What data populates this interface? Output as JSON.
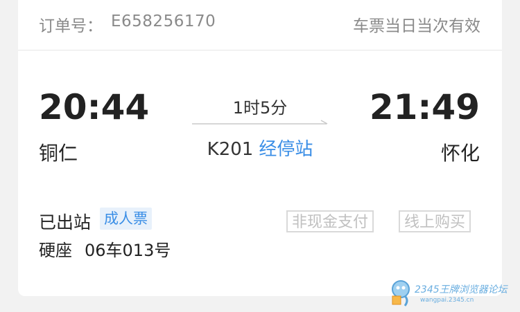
{
  "order": {
    "label": "订单号：",
    "number": "E658256170",
    "validity": "车票当日当次有效"
  },
  "journey": {
    "departure": {
      "time": "20:44",
      "station": "铜仁"
    },
    "arrival": {
      "time": "21:49",
      "station": "怀化"
    },
    "duration": "1时5分",
    "train_no": "K201",
    "stops_link": "经停站"
  },
  "ticket": {
    "status": "已出站",
    "type": "成人票",
    "seat_class": "硬座",
    "seat": "06车013号",
    "tags": [
      "非现金支付",
      "线上购买"
    ]
  },
  "watermark": {
    "text": "2345王牌浏览器论坛",
    "sub": "wangpai.2345.cn"
  },
  "colors": {
    "accent": "#3a8ee6",
    "tag_border": "#d9d9d9",
    "muted": "#8a8a8a"
  }
}
